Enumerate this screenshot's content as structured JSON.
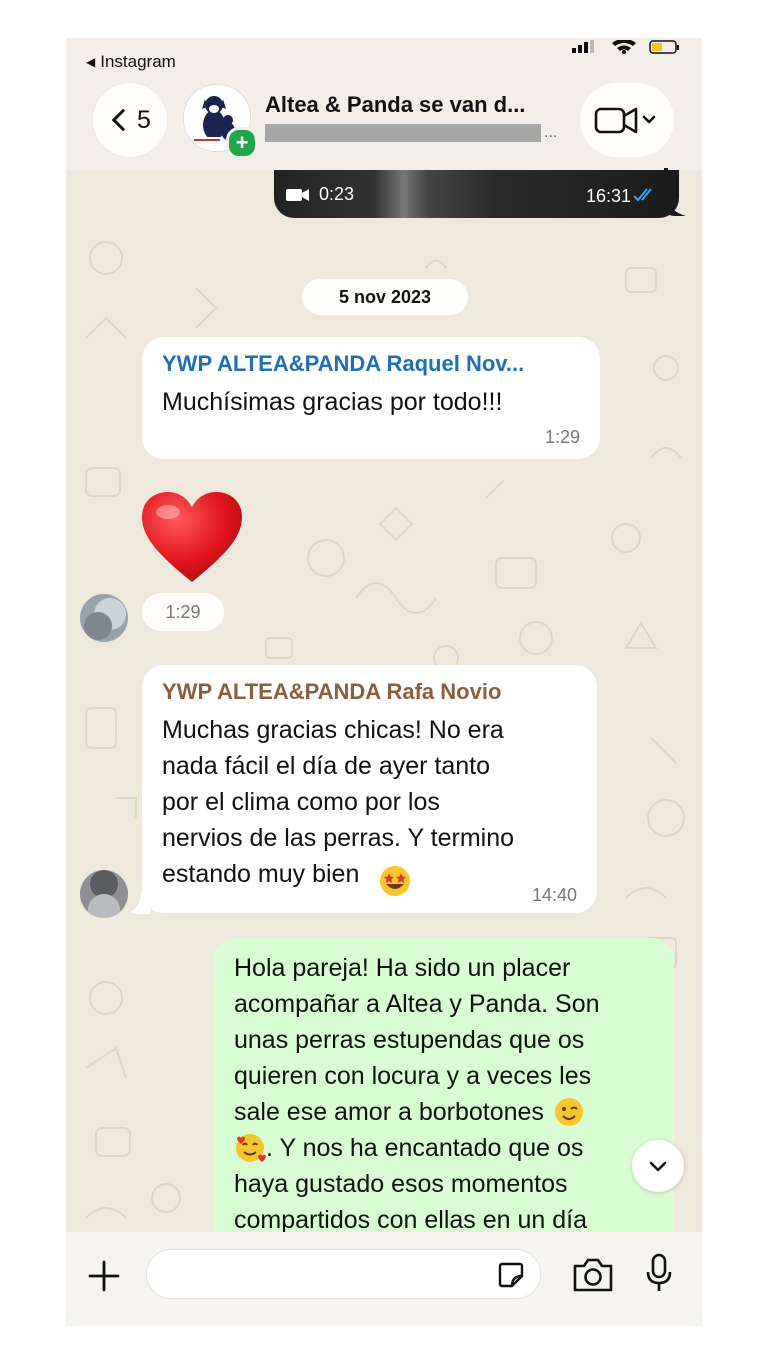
{
  "status_bar": {
    "back_app_label": "Instagram"
  },
  "header": {
    "back_count": "5",
    "chat_title": "Altea & Panda se van d...",
    "subtitle_overflow": "..."
  },
  "messages": {
    "video": {
      "duration": "0:23",
      "time": "16:31"
    },
    "date_separator": "5 nov 2023",
    "msg1": {
      "sender": "YWP ALTEA&PANDA Raquel Nov...",
      "sender_color": "#1f6fb5",
      "text": "Muchísimas gracias por todo!!!",
      "time": "1:29"
    },
    "reaction": {
      "emoji": "heart",
      "time": "1:29"
    },
    "msg2": {
      "sender": "YWP ALTEA&PANDA Rafa Novio",
      "sender_color": "#8b5e3c",
      "text": "Muchas gracias chicas! No era\nnada fácil el día de ayer tanto\npor el clima como por los\nnervios de las perras. Y termino\nestando muy bien",
      "time": "14:40"
    },
    "msg3": {
      "lines": [
        "Hola pareja! Ha sido un placer",
        "acompañar a Altea y Panda. Son",
        "unas perras estupendas que os",
        "quieren con locura y a veces les",
        "sale ese amor a borbotones",
        ". Y nos ha encantado que os",
        "haya gustado esos momentos",
        "compartidos con ellas en un día"
      ],
      "bubble_color": "#d9fdd3"
    }
  },
  "icons": {
    "add": "plus-icon",
    "sticker": "sticker-icon",
    "camera": "camera-icon",
    "mic": "microphone-icon",
    "video_call": "video-camera-icon",
    "scroll": "chevron-down-icon"
  }
}
